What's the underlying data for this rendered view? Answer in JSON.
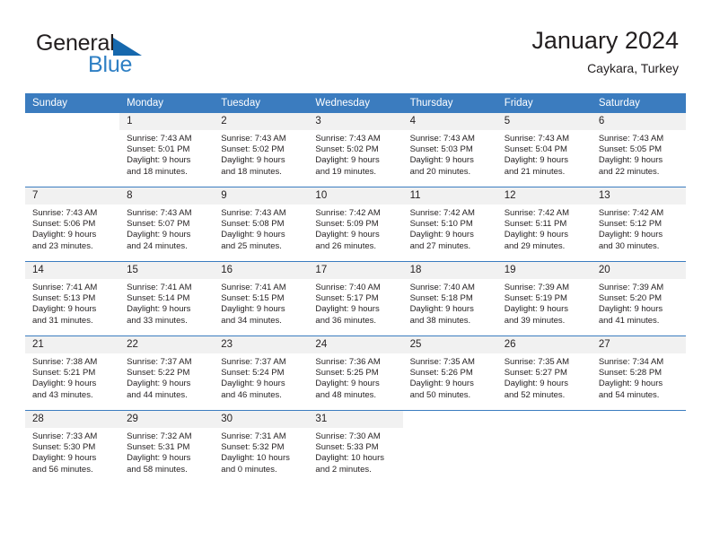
{
  "brand": {
    "line1": "General",
    "line2": "Blue",
    "accent_color": "#2e7fc4",
    "triangle_color": "#1668ad"
  },
  "header": {
    "title": "January 2024",
    "subtitle": "Caykara, Turkey"
  },
  "theme": {
    "header_bg": "#3b7cbf",
    "daynum_bg": "#f1f1f1",
    "text": "#231f20",
    "grid_line": "#3b7cbf"
  },
  "weekdays": [
    "Sunday",
    "Monday",
    "Tuesday",
    "Wednesday",
    "Thursday",
    "Friday",
    "Saturday"
  ],
  "weeks": [
    [
      {
        "day": "",
        "sunrise": "",
        "sunset": "",
        "daylight_line1": "",
        "daylight_line2": "",
        "empty": true
      },
      {
        "day": "1",
        "sunrise": "Sunrise: 7:43 AM",
        "sunset": "Sunset: 5:01 PM",
        "daylight_line1": "Daylight: 9 hours",
        "daylight_line2": "and 18 minutes."
      },
      {
        "day": "2",
        "sunrise": "Sunrise: 7:43 AM",
        "sunset": "Sunset: 5:02 PM",
        "daylight_line1": "Daylight: 9 hours",
        "daylight_line2": "and 18 minutes."
      },
      {
        "day": "3",
        "sunrise": "Sunrise: 7:43 AM",
        "sunset": "Sunset: 5:02 PM",
        "daylight_line1": "Daylight: 9 hours",
        "daylight_line2": "and 19 minutes."
      },
      {
        "day": "4",
        "sunrise": "Sunrise: 7:43 AM",
        "sunset": "Sunset: 5:03 PM",
        "daylight_line1": "Daylight: 9 hours",
        "daylight_line2": "and 20 minutes."
      },
      {
        "day": "5",
        "sunrise": "Sunrise: 7:43 AM",
        "sunset": "Sunset: 5:04 PM",
        "daylight_line1": "Daylight: 9 hours",
        "daylight_line2": "and 21 minutes."
      },
      {
        "day": "6",
        "sunrise": "Sunrise: 7:43 AM",
        "sunset": "Sunset: 5:05 PM",
        "daylight_line1": "Daylight: 9 hours",
        "daylight_line2": "and 22 minutes."
      }
    ],
    [
      {
        "day": "7",
        "sunrise": "Sunrise: 7:43 AM",
        "sunset": "Sunset: 5:06 PM",
        "daylight_line1": "Daylight: 9 hours",
        "daylight_line2": "and 23 minutes."
      },
      {
        "day": "8",
        "sunrise": "Sunrise: 7:43 AM",
        "sunset": "Sunset: 5:07 PM",
        "daylight_line1": "Daylight: 9 hours",
        "daylight_line2": "and 24 minutes."
      },
      {
        "day": "9",
        "sunrise": "Sunrise: 7:43 AM",
        "sunset": "Sunset: 5:08 PM",
        "daylight_line1": "Daylight: 9 hours",
        "daylight_line2": "and 25 minutes."
      },
      {
        "day": "10",
        "sunrise": "Sunrise: 7:42 AM",
        "sunset": "Sunset: 5:09 PM",
        "daylight_line1": "Daylight: 9 hours",
        "daylight_line2": "and 26 minutes."
      },
      {
        "day": "11",
        "sunrise": "Sunrise: 7:42 AM",
        "sunset": "Sunset: 5:10 PM",
        "daylight_line1": "Daylight: 9 hours",
        "daylight_line2": "and 27 minutes."
      },
      {
        "day": "12",
        "sunrise": "Sunrise: 7:42 AM",
        "sunset": "Sunset: 5:11 PM",
        "daylight_line1": "Daylight: 9 hours",
        "daylight_line2": "and 29 minutes."
      },
      {
        "day": "13",
        "sunrise": "Sunrise: 7:42 AM",
        "sunset": "Sunset: 5:12 PM",
        "daylight_line1": "Daylight: 9 hours",
        "daylight_line2": "and 30 minutes."
      }
    ],
    [
      {
        "day": "14",
        "sunrise": "Sunrise: 7:41 AM",
        "sunset": "Sunset: 5:13 PM",
        "daylight_line1": "Daylight: 9 hours",
        "daylight_line2": "and 31 minutes."
      },
      {
        "day": "15",
        "sunrise": "Sunrise: 7:41 AM",
        "sunset": "Sunset: 5:14 PM",
        "daylight_line1": "Daylight: 9 hours",
        "daylight_line2": "and 33 minutes."
      },
      {
        "day": "16",
        "sunrise": "Sunrise: 7:41 AM",
        "sunset": "Sunset: 5:15 PM",
        "daylight_line1": "Daylight: 9 hours",
        "daylight_line2": "and 34 minutes."
      },
      {
        "day": "17",
        "sunrise": "Sunrise: 7:40 AM",
        "sunset": "Sunset: 5:17 PM",
        "daylight_line1": "Daylight: 9 hours",
        "daylight_line2": "and 36 minutes."
      },
      {
        "day": "18",
        "sunrise": "Sunrise: 7:40 AM",
        "sunset": "Sunset: 5:18 PM",
        "daylight_line1": "Daylight: 9 hours",
        "daylight_line2": "and 38 minutes."
      },
      {
        "day": "19",
        "sunrise": "Sunrise: 7:39 AM",
        "sunset": "Sunset: 5:19 PM",
        "daylight_line1": "Daylight: 9 hours",
        "daylight_line2": "and 39 minutes."
      },
      {
        "day": "20",
        "sunrise": "Sunrise: 7:39 AM",
        "sunset": "Sunset: 5:20 PM",
        "daylight_line1": "Daylight: 9 hours",
        "daylight_line2": "and 41 minutes."
      }
    ],
    [
      {
        "day": "21",
        "sunrise": "Sunrise: 7:38 AM",
        "sunset": "Sunset: 5:21 PM",
        "daylight_line1": "Daylight: 9 hours",
        "daylight_line2": "and 43 minutes."
      },
      {
        "day": "22",
        "sunrise": "Sunrise: 7:37 AM",
        "sunset": "Sunset: 5:22 PM",
        "daylight_line1": "Daylight: 9 hours",
        "daylight_line2": "and 44 minutes."
      },
      {
        "day": "23",
        "sunrise": "Sunrise: 7:37 AM",
        "sunset": "Sunset: 5:24 PM",
        "daylight_line1": "Daylight: 9 hours",
        "daylight_line2": "and 46 minutes."
      },
      {
        "day": "24",
        "sunrise": "Sunrise: 7:36 AM",
        "sunset": "Sunset: 5:25 PM",
        "daylight_line1": "Daylight: 9 hours",
        "daylight_line2": "and 48 minutes."
      },
      {
        "day": "25",
        "sunrise": "Sunrise: 7:35 AM",
        "sunset": "Sunset: 5:26 PM",
        "daylight_line1": "Daylight: 9 hours",
        "daylight_line2": "and 50 minutes."
      },
      {
        "day": "26",
        "sunrise": "Sunrise: 7:35 AM",
        "sunset": "Sunset: 5:27 PM",
        "daylight_line1": "Daylight: 9 hours",
        "daylight_line2": "and 52 minutes."
      },
      {
        "day": "27",
        "sunrise": "Sunrise: 7:34 AM",
        "sunset": "Sunset: 5:28 PM",
        "daylight_line1": "Daylight: 9 hours",
        "daylight_line2": "and 54 minutes."
      }
    ],
    [
      {
        "day": "28",
        "sunrise": "Sunrise: 7:33 AM",
        "sunset": "Sunset: 5:30 PM",
        "daylight_line1": "Daylight: 9 hours",
        "daylight_line2": "and 56 minutes."
      },
      {
        "day": "29",
        "sunrise": "Sunrise: 7:32 AM",
        "sunset": "Sunset: 5:31 PM",
        "daylight_line1": "Daylight: 9 hours",
        "daylight_line2": "and 58 minutes."
      },
      {
        "day": "30",
        "sunrise": "Sunrise: 7:31 AM",
        "sunset": "Sunset: 5:32 PM",
        "daylight_line1": "Daylight: 10 hours",
        "daylight_line2": "and 0 minutes."
      },
      {
        "day": "31",
        "sunrise": "Sunrise: 7:30 AM",
        "sunset": "Sunset: 5:33 PM",
        "daylight_line1": "Daylight: 10 hours",
        "daylight_line2": "and 2 minutes."
      },
      {
        "day": "",
        "sunrise": "",
        "sunset": "",
        "daylight_line1": "",
        "daylight_line2": "",
        "empty": true
      },
      {
        "day": "",
        "sunrise": "",
        "sunset": "",
        "daylight_line1": "",
        "daylight_line2": "",
        "empty": true
      },
      {
        "day": "",
        "sunrise": "",
        "sunset": "",
        "daylight_line1": "",
        "daylight_line2": "",
        "empty": true
      }
    ]
  ]
}
